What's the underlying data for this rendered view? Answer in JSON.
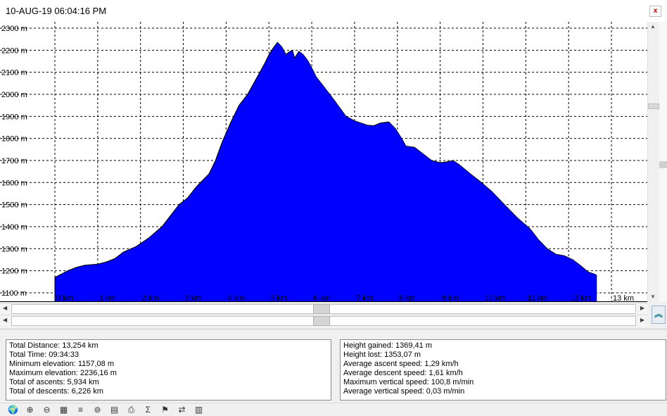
{
  "window": {
    "title": "10-AUG-19 06:04:16 PM",
    "close_label": "x"
  },
  "chart_data": {
    "type": "area",
    "title": "",
    "xlabel": "",
    "ylabel": "",
    "x_unit": "km",
    "y_unit": "m",
    "xlim": [
      0,
      13.3
    ],
    "ylim": [
      1100,
      2300
    ],
    "grid": true,
    "fill_color": "#0000ff",
    "y_ticks": [
      "2300 m",
      "2200 m",
      "2100 m",
      "2000 m",
      "1900 m",
      "1800 m",
      "1700 m",
      "1600 m",
      "1500 m",
      "1400 m",
      "1300 m",
      "1200 m",
      "1100 m"
    ],
    "x_ticks": [
      "0 km",
      "1 km",
      "2 km",
      "3 km",
      "4 km",
      "5 km",
      "6 km",
      "7 km",
      "8 km",
      "9 km",
      "10 km",
      "11 km",
      "12 km",
      "13 km"
    ],
    "x": [
      0,
      0.1,
      0.3,
      0.5,
      0.7,
      1.0,
      1.2,
      1.4,
      1.6,
      1.9,
      2.2,
      2.5,
      2.7,
      2.9,
      3.1,
      3.3,
      3.6,
      3.75,
      3.9,
      4.1,
      4.3,
      4.5,
      4.7,
      4.9,
      5.0,
      5.1,
      5.2,
      5.3,
      5.4,
      5.45,
      5.55,
      5.6,
      5.7,
      5.8,
      5.9,
      6.0,
      6.1,
      6.3,
      6.5,
      6.8,
      7.0,
      7.3,
      7.45,
      7.6,
      7.8,
      7.95,
      8.1,
      8.2,
      8.4,
      8.6,
      8.8,
      9.0,
      9.2,
      9.3,
      9.45,
      9.7,
      9.9,
      10.2,
      10.5,
      10.8,
      11.1,
      11.3,
      11.5,
      11.7,
      11.9,
      12.1,
      12.3,
      12.45,
      12.6,
      12.65
    ],
    "y": [
      1170,
      1180,
      1200,
      1215,
      1225,
      1230,
      1240,
      1255,
      1285,
      1310,
      1350,
      1400,
      1450,
      1500,
      1530,
      1580,
      1640,
      1700,
      1780,
      1870,
      1950,
      2000,
      2070,
      2140,
      2180,
      2210,
      2236,
      2215,
      2180,
      2190,
      2200,
      2165,
      2195,
      2180,
      2155,
      2120,
      2080,
      2030,
      1980,
      1900,
      1880,
      1860,
      1858,
      1870,
      1875,
      1845,
      1800,
      1765,
      1760,
      1730,
      1700,
      1690,
      1695,
      1700,
      1680,
      1640,
      1610,
      1560,
      1500,
      1440,
      1390,
      1340,
      1300,
      1275,
      1268,
      1250,
      1220,
      1195,
      1185,
      1180
    ]
  },
  "stats_left": [
    "Total Distance: 13,254 km",
    "Total Time: 09:34:33",
    "Minimum elevation: 1157,08 m",
    "Maximum elevation: 2236,16 m",
    "Total of ascents: 5,934 km",
    "Total of descents: 6,226 km"
  ],
  "stats_right": [
    "Height gained: 1369,41 m",
    "Height lost: 1353,07 m",
    "Average ascent speed: 1,29 km/h",
    "Average descent speed: 1,61 km/h",
    "Maximum vertical speed: 100,8 m/min",
    "Average vertical speed: 0,03 m/min"
  ],
  "toolbar_icons": [
    "globe-icon",
    "zoom-in-icon",
    "zoom-out-icon",
    "grid-icon",
    "speed-icon",
    "search-track-icon",
    "notes-icon",
    "print-icon",
    "sum-icon",
    "marker-icon",
    "swap-icon",
    "export-icon"
  ],
  "icon_glyphs": [
    "🌍",
    "⊕",
    "⊖",
    "▦",
    "≡",
    "⊚",
    "▤",
    "⎙",
    "Σ",
    "⚑",
    "⇄",
    "▥"
  ]
}
